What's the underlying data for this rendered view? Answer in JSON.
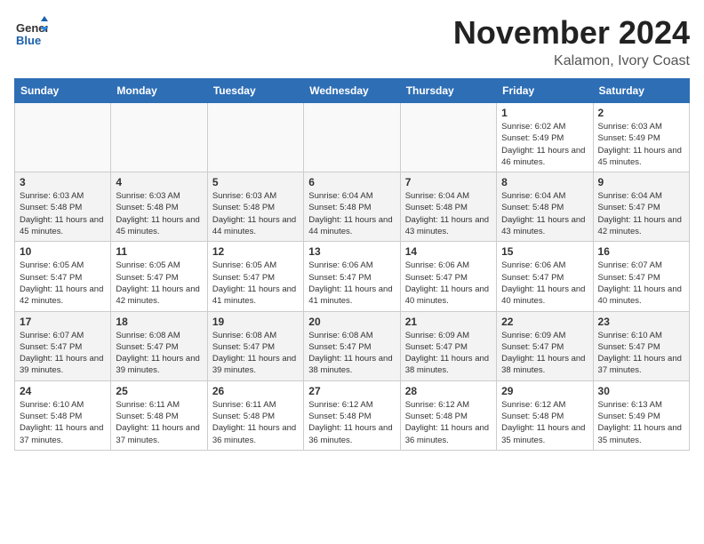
{
  "header": {
    "logo_general": "General",
    "logo_blue": "Blue",
    "month_title": "November 2024",
    "location": "Kalamon, Ivory Coast"
  },
  "weekdays": [
    "Sunday",
    "Monday",
    "Tuesday",
    "Wednesday",
    "Thursday",
    "Friday",
    "Saturday"
  ],
  "weeks": [
    [
      {
        "day": "",
        "info": ""
      },
      {
        "day": "",
        "info": ""
      },
      {
        "day": "",
        "info": ""
      },
      {
        "day": "",
        "info": ""
      },
      {
        "day": "",
        "info": ""
      },
      {
        "day": "1",
        "info": "Sunrise: 6:02 AM\nSunset: 5:49 PM\nDaylight: 11 hours and 46 minutes."
      },
      {
        "day": "2",
        "info": "Sunrise: 6:03 AM\nSunset: 5:49 PM\nDaylight: 11 hours and 45 minutes."
      }
    ],
    [
      {
        "day": "3",
        "info": "Sunrise: 6:03 AM\nSunset: 5:48 PM\nDaylight: 11 hours and 45 minutes."
      },
      {
        "day": "4",
        "info": "Sunrise: 6:03 AM\nSunset: 5:48 PM\nDaylight: 11 hours and 45 minutes."
      },
      {
        "day": "5",
        "info": "Sunrise: 6:03 AM\nSunset: 5:48 PM\nDaylight: 11 hours and 44 minutes."
      },
      {
        "day": "6",
        "info": "Sunrise: 6:04 AM\nSunset: 5:48 PM\nDaylight: 11 hours and 44 minutes."
      },
      {
        "day": "7",
        "info": "Sunrise: 6:04 AM\nSunset: 5:48 PM\nDaylight: 11 hours and 43 minutes."
      },
      {
        "day": "8",
        "info": "Sunrise: 6:04 AM\nSunset: 5:48 PM\nDaylight: 11 hours and 43 minutes."
      },
      {
        "day": "9",
        "info": "Sunrise: 6:04 AM\nSunset: 5:47 PM\nDaylight: 11 hours and 42 minutes."
      }
    ],
    [
      {
        "day": "10",
        "info": "Sunrise: 6:05 AM\nSunset: 5:47 PM\nDaylight: 11 hours and 42 minutes."
      },
      {
        "day": "11",
        "info": "Sunrise: 6:05 AM\nSunset: 5:47 PM\nDaylight: 11 hours and 42 minutes."
      },
      {
        "day": "12",
        "info": "Sunrise: 6:05 AM\nSunset: 5:47 PM\nDaylight: 11 hours and 41 minutes."
      },
      {
        "day": "13",
        "info": "Sunrise: 6:06 AM\nSunset: 5:47 PM\nDaylight: 11 hours and 41 minutes."
      },
      {
        "day": "14",
        "info": "Sunrise: 6:06 AM\nSunset: 5:47 PM\nDaylight: 11 hours and 40 minutes."
      },
      {
        "day": "15",
        "info": "Sunrise: 6:06 AM\nSunset: 5:47 PM\nDaylight: 11 hours and 40 minutes."
      },
      {
        "day": "16",
        "info": "Sunrise: 6:07 AM\nSunset: 5:47 PM\nDaylight: 11 hours and 40 minutes."
      }
    ],
    [
      {
        "day": "17",
        "info": "Sunrise: 6:07 AM\nSunset: 5:47 PM\nDaylight: 11 hours and 39 minutes."
      },
      {
        "day": "18",
        "info": "Sunrise: 6:08 AM\nSunset: 5:47 PM\nDaylight: 11 hours and 39 minutes."
      },
      {
        "day": "19",
        "info": "Sunrise: 6:08 AM\nSunset: 5:47 PM\nDaylight: 11 hours and 39 minutes."
      },
      {
        "day": "20",
        "info": "Sunrise: 6:08 AM\nSunset: 5:47 PM\nDaylight: 11 hours and 38 minutes."
      },
      {
        "day": "21",
        "info": "Sunrise: 6:09 AM\nSunset: 5:47 PM\nDaylight: 11 hours and 38 minutes."
      },
      {
        "day": "22",
        "info": "Sunrise: 6:09 AM\nSunset: 5:47 PM\nDaylight: 11 hours and 38 minutes."
      },
      {
        "day": "23",
        "info": "Sunrise: 6:10 AM\nSunset: 5:47 PM\nDaylight: 11 hours and 37 minutes."
      }
    ],
    [
      {
        "day": "24",
        "info": "Sunrise: 6:10 AM\nSunset: 5:48 PM\nDaylight: 11 hours and 37 minutes."
      },
      {
        "day": "25",
        "info": "Sunrise: 6:11 AM\nSunset: 5:48 PM\nDaylight: 11 hours and 37 minutes."
      },
      {
        "day": "26",
        "info": "Sunrise: 6:11 AM\nSunset: 5:48 PM\nDaylight: 11 hours and 36 minutes."
      },
      {
        "day": "27",
        "info": "Sunrise: 6:12 AM\nSunset: 5:48 PM\nDaylight: 11 hours and 36 minutes."
      },
      {
        "day": "28",
        "info": "Sunrise: 6:12 AM\nSunset: 5:48 PM\nDaylight: 11 hours and 36 minutes."
      },
      {
        "day": "29",
        "info": "Sunrise: 6:12 AM\nSunset: 5:48 PM\nDaylight: 11 hours and 35 minutes."
      },
      {
        "day": "30",
        "info": "Sunrise: 6:13 AM\nSunset: 5:49 PM\nDaylight: 11 hours and 35 minutes."
      }
    ]
  ]
}
